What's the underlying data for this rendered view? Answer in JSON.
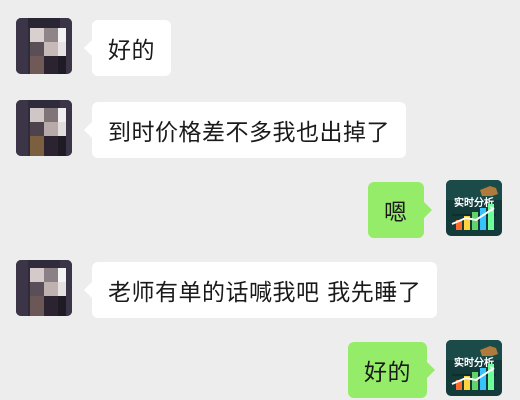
{
  "chat": {
    "messages": [
      {
        "side": "in",
        "text": "好的"
      },
      {
        "side": "in",
        "text": "到时价格差不多我也出掉了"
      },
      {
        "side": "out",
        "text": "嗯"
      },
      {
        "side": "in",
        "text": "老师有单的话喊我吧 我先睡了"
      },
      {
        "side": "out",
        "text": "好的"
      }
    ]
  },
  "avatars": {
    "contact": "pixelated-avatar",
    "self_logo_text": "实时分析"
  },
  "colors": {
    "background": "#ededed",
    "incoming_bubble": "#ffffff",
    "outgoing_bubble": "#95ec69"
  }
}
